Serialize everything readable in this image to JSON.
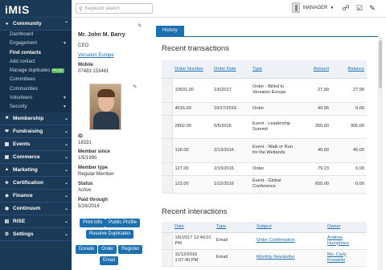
{
  "app": {
    "logo": "iMIS"
  },
  "sidebar": {
    "sections": [
      {
        "label": "Community",
        "icon": "community-icon",
        "expanded": true,
        "items": [
          {
            "label": "Dashboard"
          },
          {
            "label": "Engagement",
            "has_children": true
          },
          {
            "label": "Find contacts",
            "active": true
          },
          {
            "label": "Add contact"
          },
          {
            "label": "Manage duplicates",
            "badge": "PLUS"
          },
          {
            "label": "Committees"
          },
          {
            "label": "Communities"
          },
          {
            "label": "Volunteers",
            "has_children": true
          },
          {
            "label": "Security",
            "has_children": true
          }
        ]
      },
      {
        "label": "Membership",
        "icon": "membership-icon"
      },
      {
        "label": "Fundraising",
        "icon": "fundraising-icon"
      },
      {
        "label": "Events",
        "icon": "events-icon"
      },
      {
        "label": "Commerce",
        "icon": "commerce-icon"
      },
      {
        "label": "Marketing",
        "icon": "marketing-icon"
      },
      {
        "label": "Certification",
        "icon": "certification-icon"
      },
      {
        "label": "Finance",
        "icon": "finance-icon"
      },
      {
        "label": "Continuum",
        "icon": "continuum-icon"
      },
      {
        "label": "RiSE",
        "icon": "rise-icon"
      },
      {
        "label": "Settings",
        "icon": "settings-icon"
      }
    ]
  },
  "topbar": {
    "search_placeholder": "Keyword search",
    "user_name": "MANAGER"
  },
  "profile": {
    "name": "Mr. John M. Barry",
    "title": "CEO",
    "company": "Versaton Europe",
    "mobile_label": "Mobile",
    "mobile": "07483 153461",
    "id_label": "ID",
    "id": "18331",
    "member_since_label": "Member since",
    "member_since": "1/5/1990",
    "member_type_label": "Member type",
    "member_type": "Regular Member",
    "status_label": "Status",
    "status": "Active",
    "paid_through_label": "Paid through",
    "paid_through": "5/26/2016",
    "buttons": {
      "print_info": "Print Info",
      "public_profile": "Public Profile",
      "resolve_duplicates": "Resolve Duplicates",
      "donate": "Donate",
      "order": "Order",
      "register": "Register",
      "email": "Email"
    }
  },
  "main": {
    "tab": "History",
    "transactions": {
      "heading": "Recent transactions",
      "columns": [
        "Order Number",
        "Order Date",
        "Type",
        "Amount",
        "Balance"
      ],
      "rows": [
        {
          "order": "10531.00",
          "date": "1/6/2017",
          "type": "Order - Billed to Versaton Europe",
          "amount": "27.99",
          "balance": "27.99"
        },
        {
          "order": "4616.00",
          "date": "10/17/2016",
          "type": "Order",
          "amount": "49.96",
          "balance": "0.00"
        },
        {
          "order": "2802.00",
          "date": "5/5/2016",
          "type": "Event - Leadership Summit",
          "amount": "305.00",
          "balance": "305.00"
        },
        {
          "order": "126.00",
          "date": "2/13/2016",
          "type": "Event - Walk or Run for the Wetlands",
          "amount": "45.00",
          "balance": "45.00"
        },
        {
          "order": "127.00",
          "date": "2/13/2016",
          "type": "Order",
          "amount": "79.23",
          "balance": "0.00"
        },
        {
          "order": "122.00",
          "date": "1/12/2016",
          "type": "Event - Global Conference",
          "amount": "655.00",
          "balance": "0.00"
        }
      ]
    },
    "interactions": {
      "heading": "Recent interactions",
      "columns": [
        "Date",
        "Type",
        "Subject",
        "Owner"
      ],
      "rows": [
        {
          "date": "1/6/2017 12:46:01 PM",
          "type": "Email",
          "subject": "Order Confirmation",
          "owner": "Andrew Humphries"
        },
        {
          "date": "11/12/2016 1:07:40 PM",
          "type": "Email",
          "subject": "Monthly Newsletter",
          "owner": "Ms. Carly Kowalski"
        }
      ]
    }
  }
}
